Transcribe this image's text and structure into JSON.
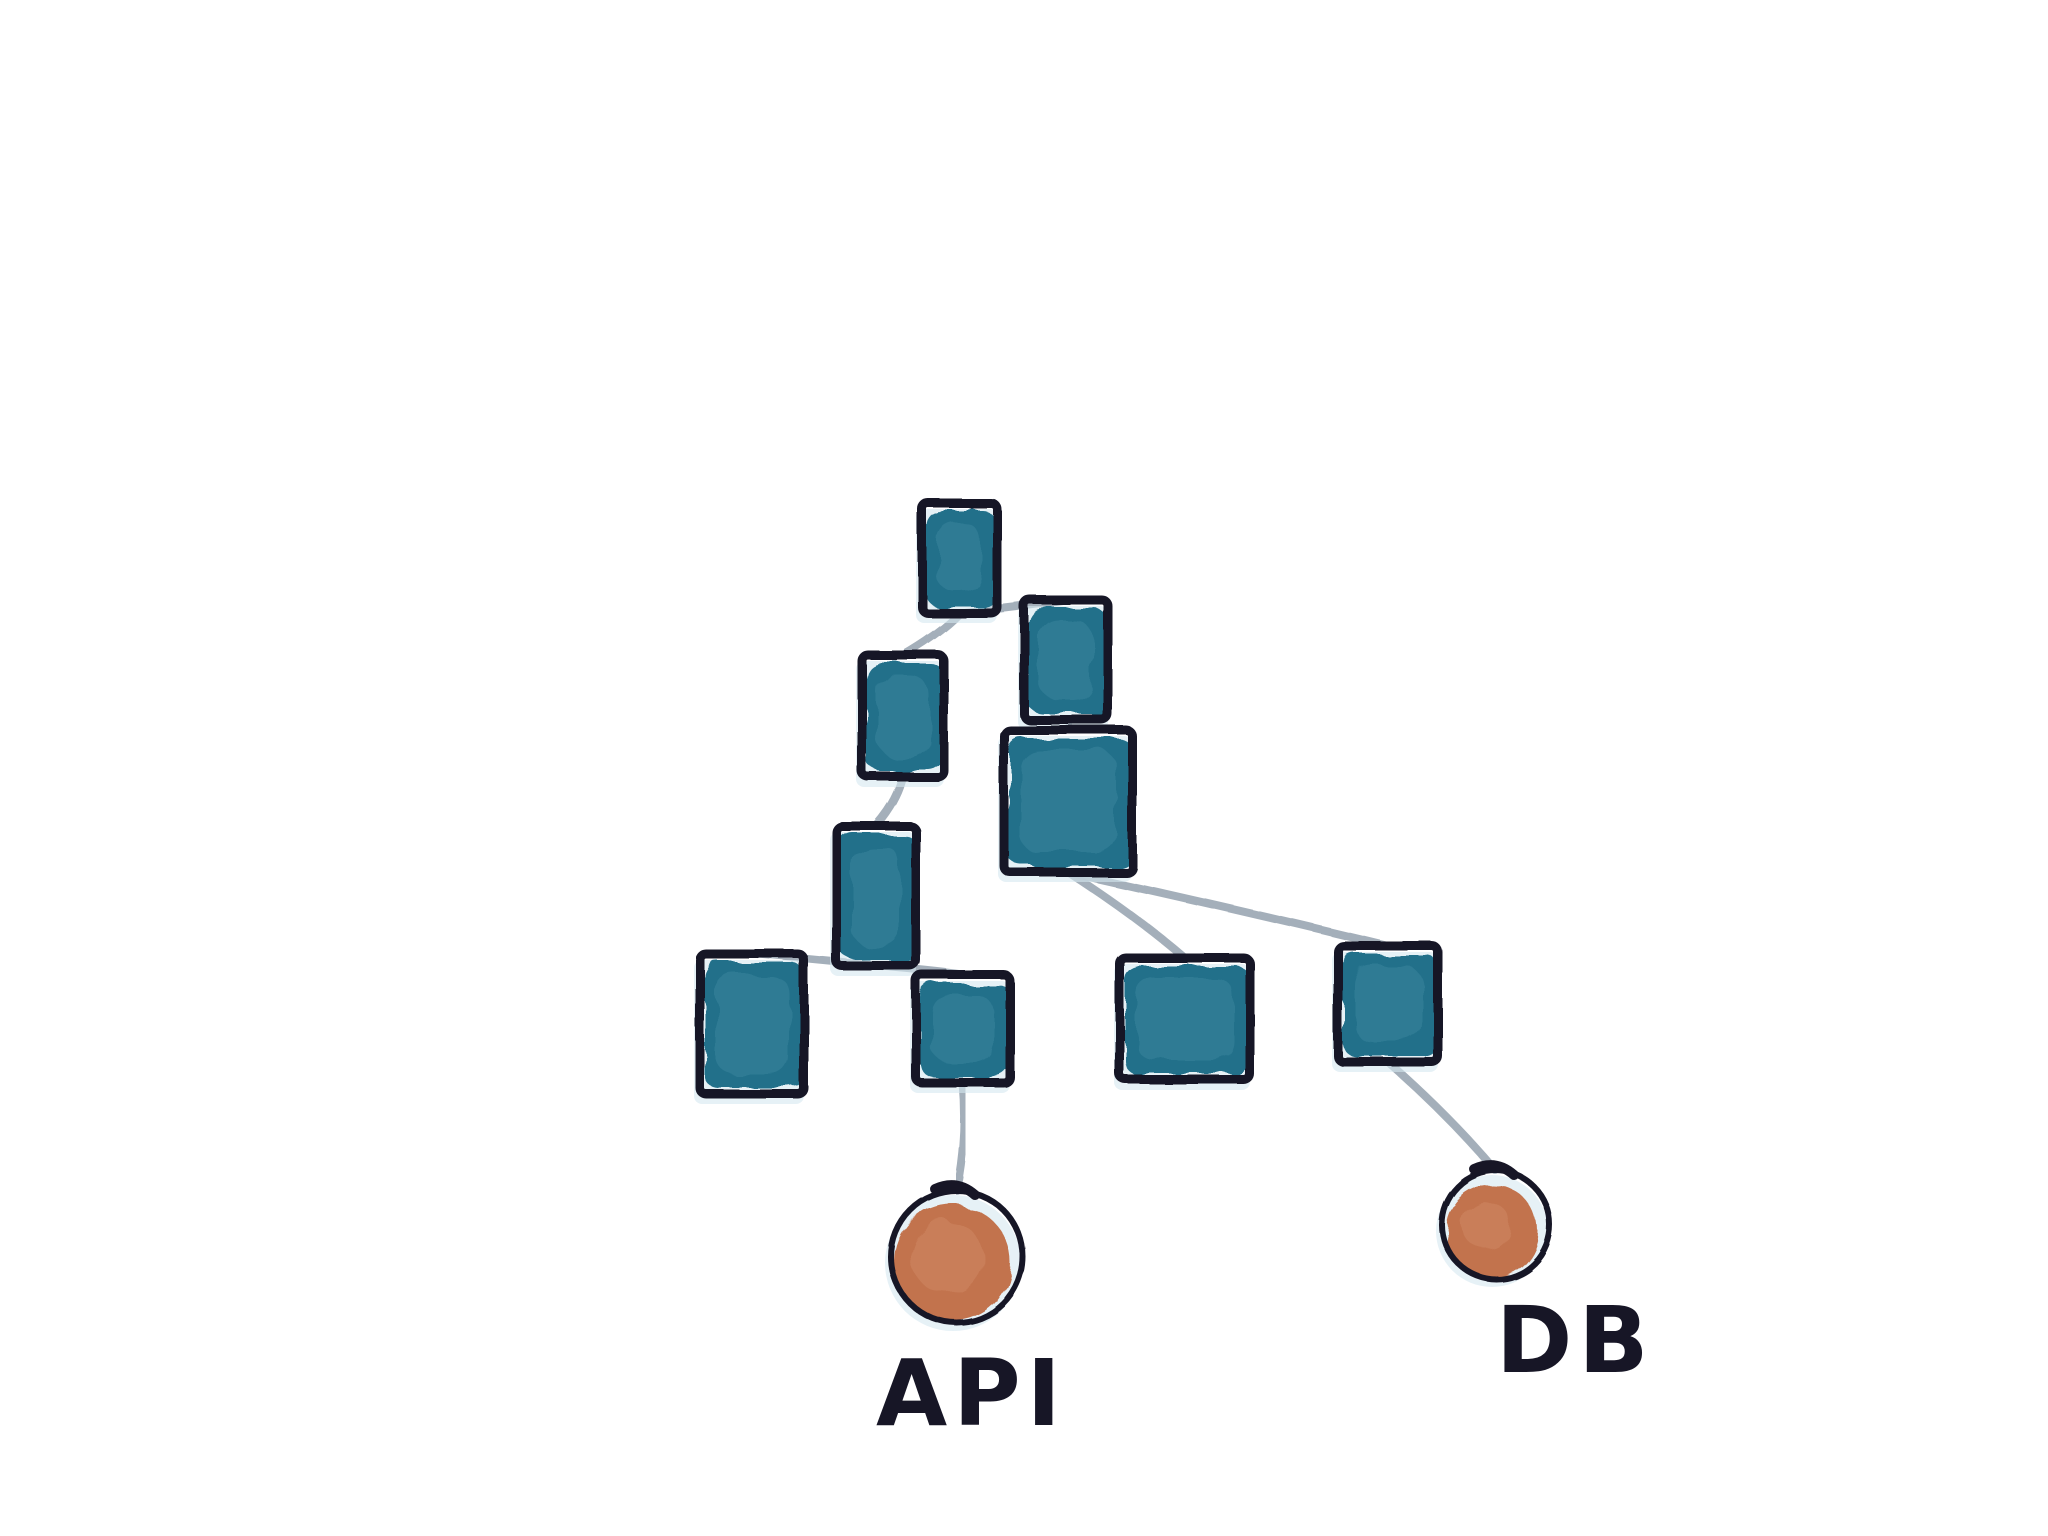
{
  "diagram": {
    "type": "component-tree",
    "colors": {
      "background": "#ffffff",
      "component_fill": "#22708a",
      "component_fill_light": "#3f8aa1",
      "service_fill": "#c2734d",
      "service_fill_light": "#d08a66",
      "ink": "#171626",
      "connector": "#9aa6b2",
      "shadow": "#d6e8f0"
    },
    "components": [
      {
        "id": "root"
      },
      {
        "id": "a"
      },
      {
        "id": "b"
      },
      {
        "id": "c"
      },
      {
        "id": "d"
      },
      {
        "id": "e"
      },
      {
        "id": "f"
      },
      {
        "id": "g"
      },
      {
        "id": "h"
      }
    ],
    "services": [
      {
        "id": "api",
        "label": "API"
      },
      {
        "id": "db",
        "label": "DB"
      }
    ],
    "connections": [
      {
        "from": "root",
        "to": "a"
      },
      {
        "from": "root",
        "to": "b"
      },
      {
        "from": "b",
        "to": "c"
      },
      {
        "from": "a",
        "to": "d"
      },
      {
        "from": "d",
        "to": "e"
      },
      {
        "from": "d",
        "to": "f"
      },
      {
        "from": "c",
        "to": "g"
      },
      {
        "from": "c",
        "to": "h"
      },
      {
        "from": "f",
        "to": "api"
      },
      {
        "from": "h",
        "to": "db"
      }
    ]
  }
}
